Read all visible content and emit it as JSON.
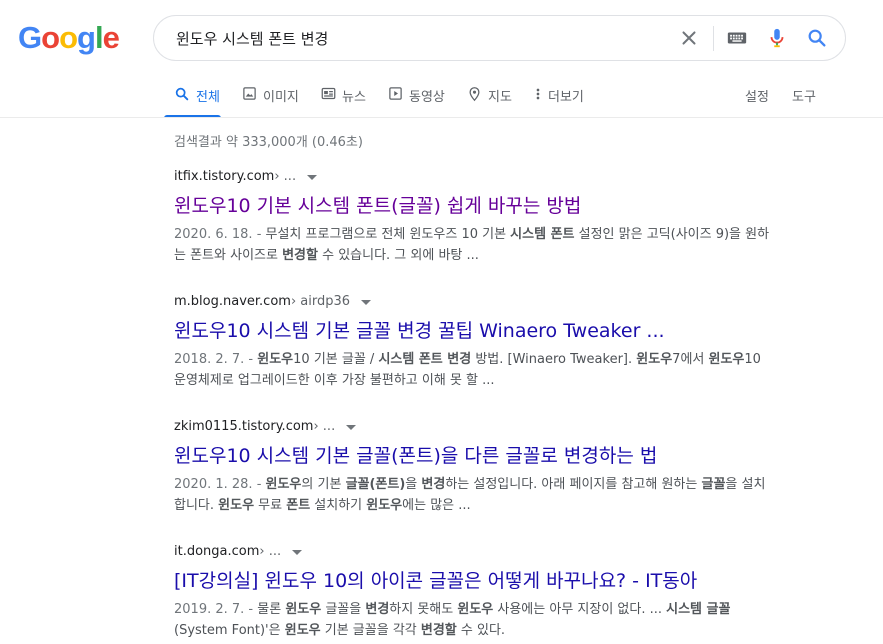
{
  "header": {
    "logo_letters": [
      "G",
      "o",
      "o",
      "g",
      "l",
      "e"
    ],
    "search_value": "윈도우 시스템 폰트 변경"
  },
  "tabs": [
    {
      "label": "전체",
      "icon": "search-icon",
      "active": true
    },
    {
      "label": "이미지",
      "icon": "image-icon"
    },
    {
      "label": "뉴스",
      "icon": "news-icon"
    },
    {
      "label": "동영상",
      "icon": "video-icon"
    },
    {
      "label": "지도",
      "icon": "map-pin-icon"
    },
    {
      "label": "더보기",
      "icon": "more-vert-icon"
    },
    {
      "label": "설정"
    },
    {
      "label": "도구"
    }
  ],
  "stats": "검색결과 약 333,000개 (0.46초)",
  "results": [
    {
      "domain": "itfix.tistory.com",
      "crumb": " › ...",
      "title": "윈도우10 기본 시스템 폰트(글꼴) 쉽게 바꾸는 방법",
      "visited": true,
      "snippet": [
        {
          "t": "2020. 6. 18. - ",
          "c": "date"
        },
        {
          "t": "무설치 프로그램으로 전체 윈도우즈 10 기본 "
        },
        {
          "t": "시스템 폰트",
          "b": true
        },
        {
          "t": " 설정인 맑은 고딕(사이즈 9)을 원하는 폰트와 사이즈로 "
        },
        {
          "t": "변경할",
          "b": true
        },
        {
          "t": " 수 있습니다. 그 외에 바탕 ..."
        }
      ]
    },
    {
      "domain": "m.blog.naver.com",
      "crumb": " › airdp36",
      "title": "윈도우10 시스템 기본 글꼴 변경 꿀팁 Winaero Tweaker ...",
      "visited": false,
      "snippet": [
        {
          "t": "2018. 2. 7. - ",
          "c": "date"
        },
        {
          "t": "윈도우",
          "b": true
        },
        {
          "t": "10 기본 글꼴 / "
        },
        {
          "t": "시스템 폰트 변경",
          "b": true
        },
        {
          "t": " 방법. [Winaero Tweaker]. "
        },
        {
          "t": "윈도우",
          "b": true
        },
        {
          "t": "7에서 "
        },
        {
          "t": "윈도우",
          "b": true
        },
        {
          "t": "10 운영체제로 업그레이드한 이후 가장 불편하고 이해 못 할 ..."
        }
      ]
    },
    {
      "domain": "zkim0115.tistory.com",
      "crumb": " › ...",
      "title": "윈도우10 시스템 기본 글꼴(폰트)을 다른 글꼴로 변경하는 법",
      "visited": false,
      "snippet": [
        {
          "t": "2020. 1. 28. - ",
          "c": "date"
        },
        {
          "t": "윈도우",
          "b": true
        },
        {
          "t": "의 기본 "
        },
        {
          "t": "글꼴(폰트)",
          "b": true
        },
        {
          "t": "을 "
        },
        {
          "t": "변경",
          "b": true
        },
        {
          "t": "하는 설정입니다. 아래 페이지를 참고해 원하는 "
        },
        {
          "t": "글꼴",
          "b": true
        },
        {
          "t": "을 설치합니다. "
        },
        {
          "t": "윈도우",
          "b": true
        },
        {
          "t": " 무료 "
        },
        {
          "t": "폰트",
          "b": true
        },
        {
          "t": " 설치하기 "
        },
        {
          "t": "윈도우",
          "b": true
        },
        {
          "t": "에는 많은 ..."
        }
      ]
    },
    {
      "domain": "it.donga.com",
      "crumb": " › ...",
      "title": "[IT강의실] 윈도우 10의 아이콘 글꼴은 어떻게 바꾸나요? - IT동아",
      "visited": false,
      "snippet": [
        {
          "t": "2019. 2. 7. - ",
          "c": "date"
        },
        {
          "t": "물론 "
        },
        {
          "t": "윈도우",
          "b": true
        },
        {
          "t": " 글꼴을 "
        },
        {
          "t": "변경",
          "b": true
        },
        {
          "t": "하지 못해도 "
        },
        {
          "t": "윈도우",
          "b": true
        },
        {
          "t": " 사용에는 아무 지장이 없다. ... "
        },
        {
          "t": "시스템 글꼴",
          "b": true
        },
        {
          "t": " (System Font)'은 "
        },
        {
          "t": "윈도우",
          "b": true
        },
        {
          "t": " 기본 글꼴을 각각 "
        },
        {
          "t": "변경할",
          "b": true
        },
        {
          "t": " 수 있다."
        }
      ]
    }
  ]
}
